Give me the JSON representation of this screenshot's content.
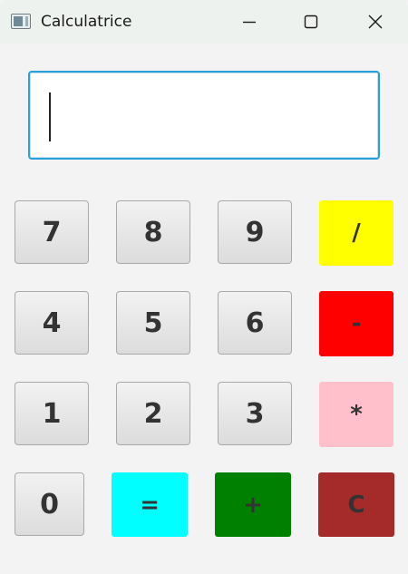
{
  "window": {
    "title": "Calculatrice",
    "controls": [
      "minimize-icon",
      "maximize-icon",
      "close-icon"
    ]
  },
  "display": {
    "value": ""
  },
  "keys": {
    "k7": "7",
    "k8": "8",
    "k9": "9",
    "div": "/",
    "k4": "4",
    "k5": "5",
    "k6": "6",
    "minus": "-",
    "k1": "1",
    "k2": "2",
    "k3": "3",
    "mul": "*",
    "k0": "0",
    "eq": "=",
    "plus": "+",
    "clear": "C"
  },
  "colors": {
    "div": "#ffff00",
    "minus": "#ff0000",
    "mul": "#ffc0cb",
    "eq": "#00ffff",
    "plus": "#008000",
    "clear": "#a52a2a",
    "display_border": "#2aa0d8"
  }
}
